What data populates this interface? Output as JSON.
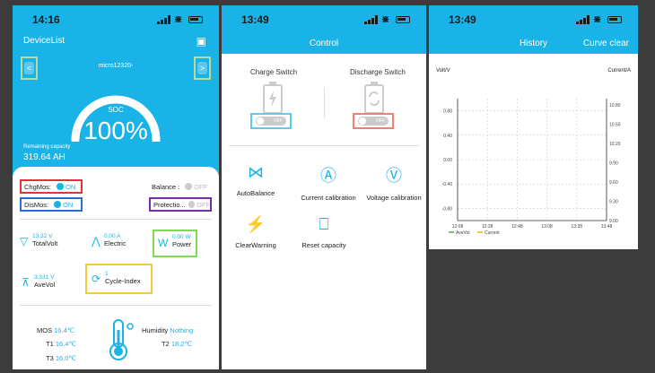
{
  "panel1": {
    "status_time": "14:16",
    "device_list_label": "DeviceList",
    "device_name": "micro12320-",
    "prev_label": "<",
    "next_label": ">",
    "soc_label": "SOC",
    "soc_value": "100%",
    "soc_fraction": 1.0,
    "remaining_label": "Remaining capacity",
    "remaining_value": "319.64 AH",
    "chg_mos_label": "ChgMos:",
    "chg_mos_state": "ON",
    "dis_mos_label": "DisMos:",
    "dis_mos_state": "ON",
    "balance_label": "Balance :",
    "balance_state": "OFF",
    "protection_label": "Protectio...",
    "protection_state": "OFF",
    "total_volt_value": "13.32 V",
    "total_volt_label": "TotalVolt",
    "electric_value": "0.00 A",
    "electric_label": "Electric",
    "power_value": "0.00 W",
    "power_label": "Power",
    "ave_vol_value": "3.331 V",
    "ave_vol_label": "AveVol",
    "cycle_value": "1",
    "cycle_label": "Cycle-Index",
    "mos_label": "MOS",
    "mos_value": "16.4℃",
    "t1_label": "T1",
    "t1_value": "16.4℃",
    "t3_label": "T3",
    "t3_value": "16.0℃",
    "humidity_label": "Humidity",
    "humidity_value": "Nothing",
    "t2_label": "T2",
    "t2_value": "18.2℃"
  },
  "panel2": {
    "status_time": "13:49",
    "title": "Control",
    "charge_switch_label": "Charge Switch",
    "charge_switch_state": "OFF",
    "discharge_switch_label": "Discharge Switch",
    "discharge_switch_state": "OFF",
    "actions": [
      {
        "label": "AutoBalance",
        "icon": "autobalance-icon"
      },
      {
        "label": "Current calibration",
        "icon": "current-calibration-icon"
      },
      {
        "label": "Voltage calibration",
        "icon": "voltage-calibration-icon"
      },
      {
        "label": "ClearWarning",
        "icon": "clear-warning-icon"
      },
      {
        "label": "Reset capacity",
        "icon": "reset-capacity-icon"
      }
    ]
  },
  "panel3": {
    "status_time": "13:49",
    "title": "History",
    "curve_clear_label": "Curve clear"
  },
  "colors": {
    "accent": "#19b3e8",
    "box_red": "#e2323a",
    "box_blue": "#2b6fd6",
    "box_purple": "#7a2fa0",
    "box_green": "#7ed957",
    "box_yellow": "#f5cb3a",
    "box_cyan": "#5fc9ee",
    "box_salmon": "#f08070",
    "nav_highlight": "#b8dd9a"
  },
  "chart_data": {
    "type": "line",
    "xlabel": "",
    "ylabel": "Volt/V",
    "ylabel_right": "Current/A",
    "x": [
      "12:08",
      "12:28",
      "12:48",
      "13:08",
      "13:28",
      "13:48"
    ],
    "y_left_ticks": [
      "0.80",
      "0.40",
      "0.00",
      "-0.40",
      "-0.80"
    ],
    "y_right_ticks": [
      "10.80",
      "10.50",
      "10.20",
      "9.90",
      "9.60",
      "9.30",
      "9.00"
    ],
    "ylim_left": [
      -1.0,
      1.0
    ],
    "ylim_right": [
      9.0,
      10.9
    ],
    "grid": true,
    "legend_position": "bottom-left",
    "series": [
      {
        "name": "AveVol",
        "color": "#4caf50",
        "values": []
      },
      {
        "name": "Current",
        "color": "#f5b400",
        "values": []
      }
    ]
  }
}
